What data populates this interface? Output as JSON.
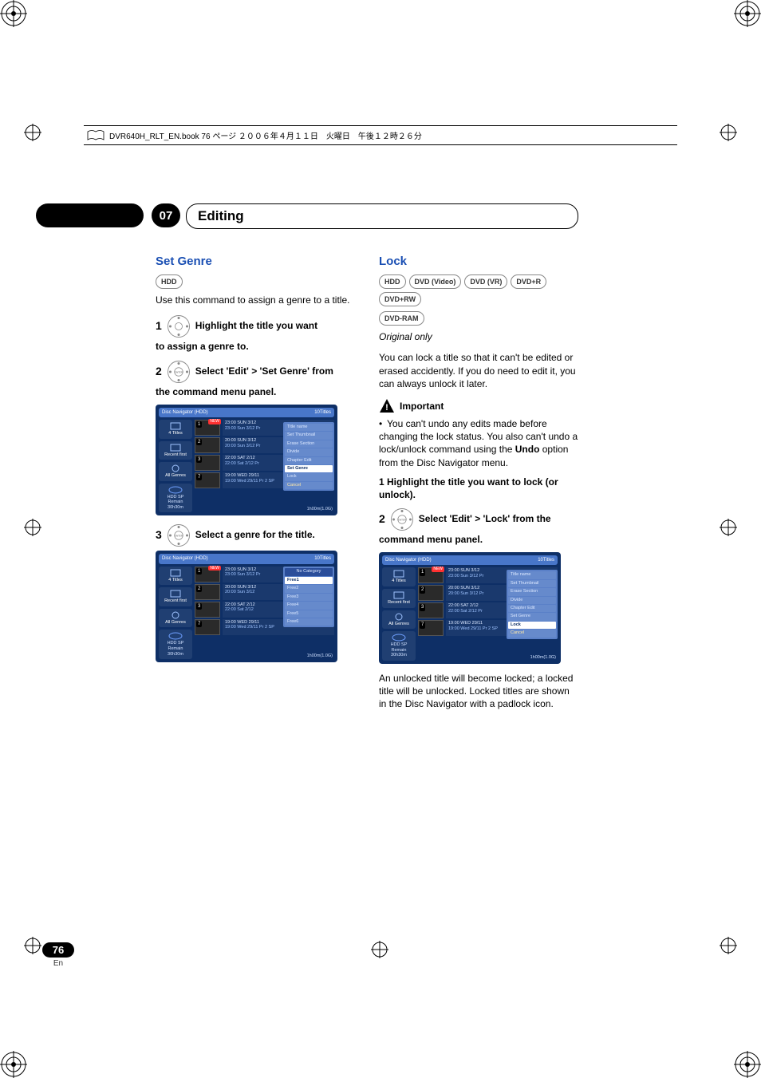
{
  "header_line": "DVR640H_RLT_EN.book  76 ページ  ２００６年４月１１日　火曜日　午後１２時２６分",
  "chapter": {
    "number": "07",
    "title": "Editing"
  },
  "left": {
    "heading": "Set Genre",
    "badge": "HDD",
    "intro": "Use this command to assign a genre to a title.",
    "step1_num": "1",
    "step1_txt": "Highlight the title you want",
    "step1_cont": "to assign a genre to.",
    "step2_num": "2",
    "step2_txt": "Select 'Edit' > 'Set Genre' from",
    "step2_cont": "the command menu panel.",
    "step3_num": "3",
    "step3_txt": "Select a genre for the title."
  },
  "right": {
    "heading": "Lock",
    "badges": [
      "HDD",
      "DVD (Video)",
      "DVD (VR)",
      "DVD+R",
      "DVD+RW",
      "DVD-RAM"
    ],
    "orig": "Original only",
    "intro": "You can lock a title so that it can't be edited or erased accidently. If you do need to edit it, you can always unlock it later.",
    "important_label": "Important",
    "important_body_a": "You can't undo any edits made before changing the lock status. You also can't undo a lock/unlock command using the ",
    "important_body_b": "Undo",
    "important_body_c": " option from the Disc Navigator menu.",
    "step1": "1    Highlight the title you want to lock (or unlock).",
    "step2_num": "2",
    "step2_txt": "Select 'Edit' > 'Lock' from the",
    "step2_cont": "command menu panel.",
    "outro": "An unlocked title will become locked; a locked title will be unlocked. Locked titles are shown in the Disc Navigator with a padlock icon."
  },
  "dn": {
    "title": "Disc Navigator (HDD)",
    "count": "10Titles",
    "side": {
      "titles": "4 Titles",
      "recent": "Recent first",
      "genres": "All Genres",
      "media": "HDD",
      "mode": "SP",
      "remain": "Remain",
      "remain_v": "30h30m"
    },
    "rows": [
      {
        "n": "1",
        "new": true,
        "t1": "23:00 SUN  3/12",
        "t2": "23:00  Sun  3/12  Pr"
      },
      {
        "n": "2",
        "new": false,
        "t1": "20:00 SUN  3/12",
        "t2": "20:00  Sun  3/12  Pr"
      },
      {
        "n": "3",
        "new": false,
        "t1": "22:00 SAT  2/12",
        "t2": "22:00  Sat  2/12  Pr"
      },
      {
        "n": "7",
        "new": false,
        "t1": "19:00 WED  29/11",
        "t2": "19:00  Wed  29/11  Pr 2  SP"
      }
    ],
    "alt_t2_2": "20:00  Sun  3/12",
    "alt_t2_3": "22:00  Sat  2/12",
    "foot": "1h00m(1.0G)",
    "menu_edit": {
      "items": [
        "Title name",
        "Set Thumbnail",
        "Erase Section",
        "Divide",
        "Chapter Edit",
        "Set Genre",
        "Lock",
        "Cancel"
      ],
      "hi_setgenre": "Set Genre",
      "hi_lock": "Lock"
    },
    "menu_genre": {
      "head": "No Category",
      "items": [
        "Free1",
        "Free2",
        "Free3",
        "Free4",
        "Free5",
        "Free6"
      ]
    }
  },
  "footer": {
    "page": "76",
    "lang": "En"
  }
}
